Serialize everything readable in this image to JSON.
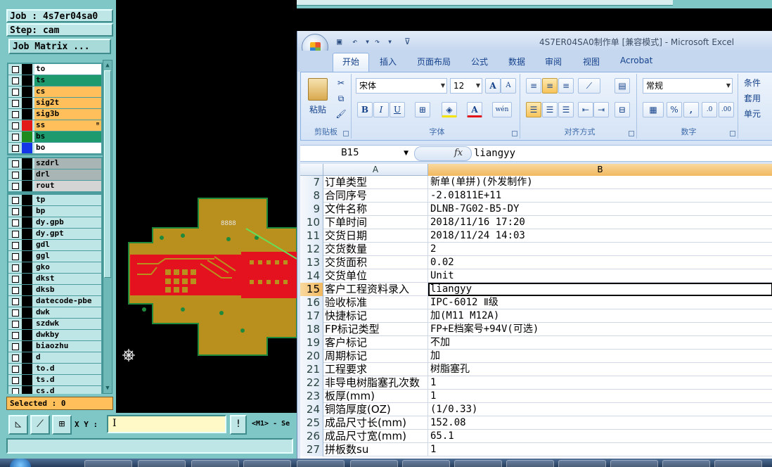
{
  "cam": {
    "job_label": "Job : 4s7er04sa0",
    "step_label": "Step: cam",
    "job_matrix_button": "Job Matrix ...",
    "selected_label": "Selected : 0",
    "xy_label": "X Y :",
    "xy_value": "I",
    "m1_label": "<M1> - Se",
    "layer_groups": [
      [
        {
          "name": "to",
          "color": "#ffffff",
          "swatch": "#000000"
        },
        {
          "name": "ts",
          "color": "#1e9b6e",
          "swatch": "#000000"
        },
        {
          "name": "cs",
          "color": "#ffc05b",
          "swatch": "#000000"
        },
        {
          "name": "sig2t",
          "color": "#ffc05b",
          "swatch": "#000000"
        },
        {
          "name": "sig3b",
          "color": "#ffc05b",
          "swatch": "#000000"
        },
        {
          "name": "ss",
          "color": "#ffc05b",
          "swatch": "#e21a1a",
          "mark": "⊞"
        },
        {
          "name": "bs",
          "color": "#1e9b6e",
          "swatch": "#1e8a1e"
        },
        {
          "name": "bo",
          "color": "#ffffff",
          "swatch": "#1536e6"
        }
      ],
      [
        {
          "name": "szdrl",
          "color": "#a9b5b5",
          "swatch": "#000000"
        },
        {
          "name": "drl",
          "color": "#a9b5b5",
          "swatch": "#000000"
        },
        {
          "name": "rout",
          "color": "#d4d4d4",
          "swatch": "#000000"
        }
      ],
      [
        {
          "name": "tp",
          "color": "#bfe6e6",
          "swatch": "#000000"
        },
        {
          "name": "bp",
          "color": "#bfe6e6",
          "swatch": "#000000"
        },
        {
          "name": "dy.gpb",
          "color": "#bfe6e6",
          "swatch": "#000000"
        },
        {
          "name": "dy.gpt",
          "color": "#bfe6e6",
          "swatch": "#000000"
        },
        {
          "name": "gdl",
          "color": "#bfe6e6",
          "swatch": "#000000"
        },
        {
          "name": "ggl",
          "color": "#bfe6e6",
          "swatch": "#000000"
        },
        {
          "name": "gko",
          "color": "#bfe6e6",
          "swatch": "#000000"
        },
        {
          "name": "dkst",
          "color": "#bfe6e6",
          "swatch": "#000000"
        },
        {
          "name": "dksb",
          "color": "#bfe6e6",
          "swatch": "#000000"
        },
        {
          "name": "datecode-pbe",
          "color": "#bfe6e6",
          "swatch": "#000000"
        },
        {
          "name": "dwk",
          "color": "#bfe6e6",
          "swatch": "#000000"
        },
        {
          "name": "szdwk",
          "color": "#bfe6e6",
          "swatch": "#000000"
        },
        {
          "name": "dwkby",
          "color": "#bfe6e6",
          "swatch": "#000000"
        },
        {
          "name": "biaozhu",
          "color": "#bfe6e6",
          "swatch": "#000000"
        },
        {
          "name": "d",
          "color": "#bfe6e6",
          "swatch": "#000000"
        },
        {
          "name": "to.d",
          "color": "#bfe6e6",
          "swatch": "#000000"
        },
        {
          "name": "ts.d",
          "color": "#bfe6e6",
          "swatch": "#000000"
        },
        {
          "name": "cs.d",
          "color": "#bfe6e6",
          "swatch": "#000000"
        }
      ]
    ],
    "tools": [
      {
        "name": "tool-snap-icon",
        "glyph": "◺"
      },
      {
        "name": "tool-measure-icon",
        "glyph": "⟋"
      },
      {
        "name": "tool-grid-icon",
        "glyph": "⊞"
      }
    ],
    "bang_button": "!",
    "board_label": "8888"
  },
  "excel": {
    "title": "4S7ER04SA0制作单 [兼容模式] - Microsoft Excel",
    "tabs": [
      "开始",
      "插入",
      "页面布局",
      "公式",
      "数据",
      "审阅",
      "视图",
      "Acrobat"
    ],
    "clipboard": {
      "paste": "粘贴",
      "label": "剪贴板"
    },
    "font": {
      "name": "宋体",
      "size": "12",
      "label": "字体",
      "bold": "B",
      "italic": "I",
      "underline": "U",
      "grow": "A",
      "shrink": "A",
      "wen": "wén",
      "fontcolor": "A"
    },
    "alignment": {
      "label": "对齐方式"
    },
    "number": {
      "format": "常规",
      "label": "数字",
      "percent": "%",
      "comma": ","
    },
    "styles": {
      "conditional": "条件",
      "table": "套用",
      "cell": "单元"
    },
    "name_box": "B15",
    "formula": "liangyy",
    "columns": {
      "a": "A",
      "b": "B"
    },
    "selected_row": 15,
    "rows": [
      {
        "n": "7",
        "a": "订单类型",
        "b": "新单(单拼)(外发制作)"
      },
      {
        "n": "8",
        "a": "合同序号",
        "b": "-2.01811E+11"
      },
      {
        "n": "9",
        "a": "文件名称",
        "b": "DLNB-7G02-B5-DY"
      },
      {
        "n": "10",
        "a": "下单时间",
        "b": "2018/11/16 17:20"
      },
      {
        "n": "11",
        "a": "交货日期",
        "b": "2018/11/24 14:03"
      },
      {
        "n": "12",
        "a": "交货数量",
        "b": "2"
      },
      {
        "n": "13",
        "a": "交货面积",
        "b": "0.02"
      },
      {
        "n": "14",
        "a": "交货单位",
        "b": "Unit"
      },
      {
        "n": "15",
        "a": "客户工程资料录入",
        "b": "liangyy"
      },
      {
        "n": "16",
        "a": "验收标准",
        "b": "IPC-6012 Ⅱ级"
      },
      {
        "n": "17",
        "a": "快捷标记",
        "b": "加(M11 M12A)"
      },
      {
        "n": "18",
        "a": "FP标记类型",
        "b": "FP+E档案号+94V(可选)"
      },
      {
        "n": "19",
        "a": "客户标记",
        "b": "不加"
      },
      {
        "n": "20",
        "a": "周期标记",
        "b": "加"
      },
      {
        "n": "21",
        "a": "工程要求",
        "b": "树脂塞孔"
      },
      {
        "n": "22",
        "a": "非导电树脂塞孔次数",
        "b": "1"
      },
      {
        "n": "23",
        "a": "板厚(mm)",
        "b": "1"
      },
      {
        "n": "24",
        "a": "铜箔厚度(OZ)",
        "b": " (1/0.33)"
      },
      {
        "n": "25",
        "a": "成品尺寸长(mm)",
        "b": "152.08"
      },
      {
        "n": "26",
        "a": "成品尺寸宽(mm)",
        "b": "65.1"
      },
      {
        "n": "27",
        "a": "拼板数su",
        "b": "1"
      }
    ]
  }
}
